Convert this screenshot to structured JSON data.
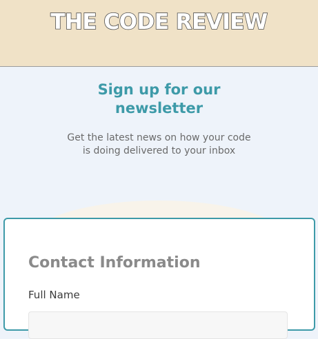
{
  "header": {
    "logo_text": "THE CODE REVIEW"
  },
  "hero": {
    "title": "Sign up for our newsletter",
    "subtitle": "Get the latest news on how your code is doing delivered to your inbox"
  },
  "form": {
    "section_title": "Contact Information",
    "full_name_label": "Full Name",
    "full_name_value": ""
  },
  "colors": {
    "header_bg": "#f0e2c7",
    "accent": "#3d9aa8",
    "page_bg": "#eef3fa"
  }
}
